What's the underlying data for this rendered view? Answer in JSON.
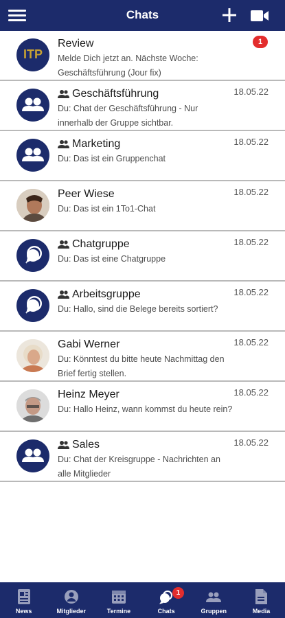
{
  "header": {
    "title": "Chats",
    "menu_icon": "hamburger-menu-icon",
    "add_icon": "plus-icon",
    "video_icon": "video-camera-icon"
  },
  "chats": [
    {
      "name": "Review",
      "preview": "Melde Dich jetzt an. Nächste Woche: Geschäftsführung (Jour fix)",
      "date": "",
      "badge": "1",
      "avatar_text": "ITP",
      "avatar_type": "logo",
      "is_group": false
    },
    {
      "name": "Geschäftsführung",
      "preview": "Du: Chat der Geschäftsführung - Nur innerhalb der Gruppe sichtbar.",
      "date": "18.05.22",
      "avatar_type": "group",
      "is_group": true
    },
    {
      "name": "Marketing",
      "preview": "Du: Das ist ein Gruppenchat",
      "date": "18.05.22",
      "avatar_type": "group",
      "is_group": true
    },
    {
      "name": "Peer Wiese",
      "preview": "Du: Das ist ein 1To1-Chat",
      "date": "18.05.22",
      "avatar_type": "photo",
      "is_group": false
    },
    {
      "name": "Chatgruppe",
      "preview": "Du: Das ist eine Chatgruppe",
      "date": "18.05.22",
      "avatar_type": "chat",
      "is_group": true
    },
    {
      "name": "Arbeitsgruppe",
      "preview": "Du: Hallo, sind die Belege bereits sortiert?",
      "date": "18.05.22",
      "avatar_type": "chat",
      "is_group": true
    },
    {
      "name": "Gabi Werner",
      "preview": "Du: Könntest du bitte heute Nachmittag den Brief fertig stellen.",
      "date": "18.05.22",
      "avatar_type": "photo",
      "is_group": false
    },
    {
      "name": "Heinz Meyer",
      "preview": "Du: Hallo Heinz, wann kommst du heute rein?",
      "date": "18.05.22",
      "avatar_type": "photo",
      "is_group": false
    },
    {
      "name": "Sales",
      "preview": "Du: Chat der Kreisgruppe - Nachrichten an alle Mitglieder",
      "date": "18.05.22",
      "avatar_type": "group",
      "is_group": true
    }
  ],
  "nav": [
    {
      "label": "News",
      "icon": "newspaper-icon",
      "active": false
    },
    {
      "label": "Mitglieder",
      "icon": "person-icon",
      "active": false
    },
    {
      "label": "Termine",
      "icon": "calendar-icon",
      "active": false
    },
    {
      "label": "Chats",
      "icon": "chat-bubbles-icon",
      "active": true,
      "badge": "1"
    },
    {
      "label": "Gruppen",
      "icon": "group-icon",
      "active": false
    },
    {
      "label": "Media",
      "icon": "document-icon",
      "active": false
    }
  ],
  "colors": {
    "primary": "#1c2b6b",
    "badge": "#e32d2d",
    "logo_gold": "#c8a233"
  }
}
